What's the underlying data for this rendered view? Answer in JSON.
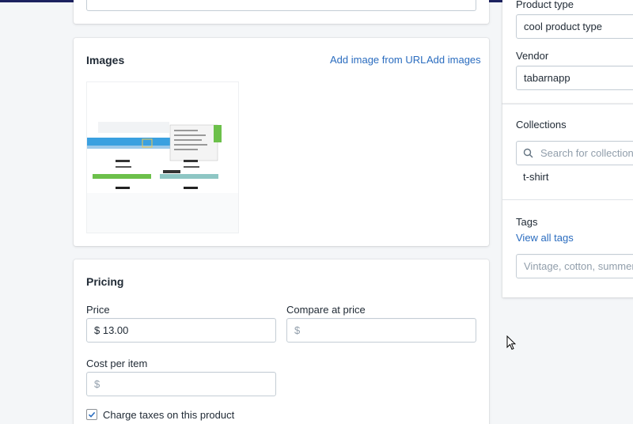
{
  "images": {
    "title": "Images",
    "add_from_url": "Add image from URL",
    "add_images": "Add images"
  },
  "pricing": {
    "title": "Pricing",
    "price_label": "Price",
    "price_value": "$ 13.00",
    "compare_label": "Compare at price",
    "compare_placeholder": "$",
    "cost_label": "Cost per item",
    "cost_placeholder": "$",
    "charge_taxes_label": "Charge taxes on this product",
    "charge_taxes_checked": true
  },
  "organization": {
    "product_type_label": "Product type",
    "product_type_value": "cool product type",
    "vendor_label": "Vendor",
    "vendor_value": "tabarnapp",
    "collections_label": "Collections",
    "collections_placeholder": "Search for collections",
    "collections_selected": [
      "t-shirt"
    ],
    "tags_label": "Tags",
    "view_all_tags": "View all tags",
    "tags_placeholder": "Vintage, cotton, summer"
  },
  "colors": {
    "link": "#2a6cbf",
    "topbar": "#1c2260",
    "background": "#f4f6f8"
  }
}
